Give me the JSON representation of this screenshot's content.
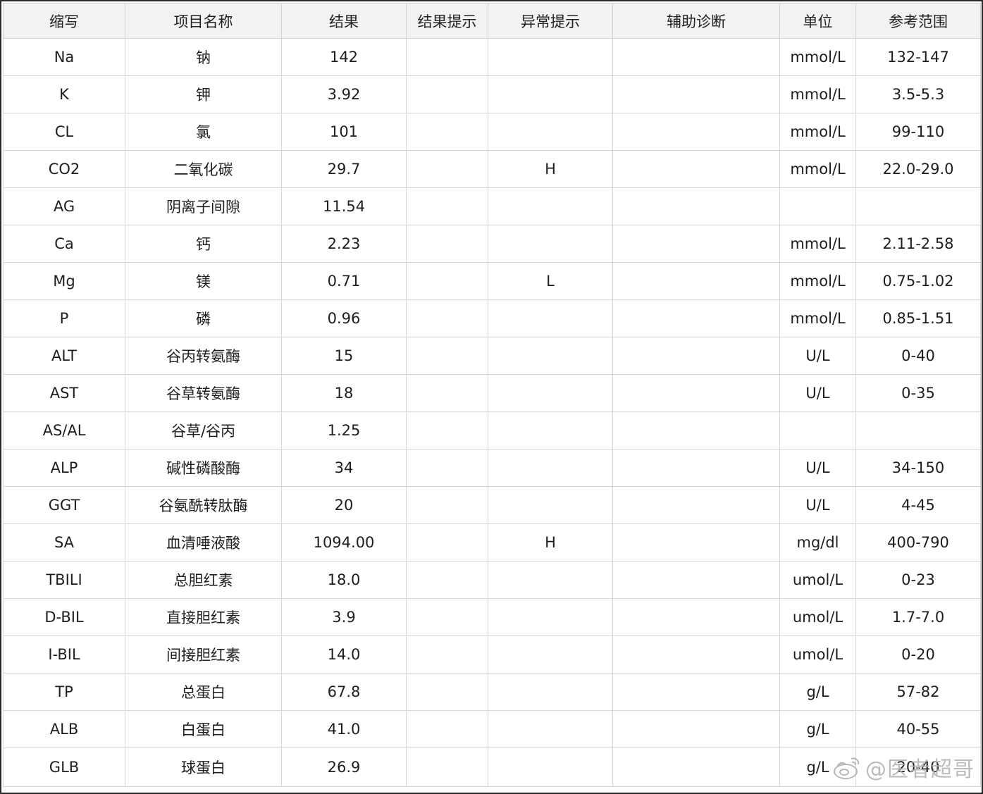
{
  "columns": [
    "缩写",
    "项目名称",
    "结果",
    "结果提示",
    "异常提示",
    "辅助诊断",
    "单位",
    "参考范围"
  ],
  "rows": [
    {
      "abbr": "Na",
      "name": "钠",
      "result": "142",
      "result_hint": "",
      "flag": "",
      "diagnosis": "",
      "unit": "mmol/L",
      "range": "132-147"
    },
    {
      "abbr": "K",
      "name": "钾",
      "result": "3.92",
      "result_hint": "",
      "flag": "",
      "diagnosis": "",
      "unit": "mmol/L",
      "range": "3.5-5.3"
    },
    {
      "abbr": "CL",
      "name": "氯",
      "result": "101",
      "result_hint": "",
      "flag": "",
      "diagnosis": "",
      "unit": "mmol/L",
      "range": "99-110"
    },
    {
      "abbr": "CO2",
      "name": "二氧化碳",
      "result": "29.7",
      "result_hint": "",
      "flag": "H",
      "diagnosis": "",
      "unit": "mmol/L",
      "range": "22.0-29.0"
    },
    {
      "abbr": "AG",
      "name": "阴离子间隙",
      "result": "11.54",
      "result_hint": "",
      "flag": "",
      "diagnosis": "",
      "unit": "",
      "range": ""
    },
    {
      "abbr": "Ca",
      "name": "钙",
      "result": "2.23",
      "result_hint": "",
      "flag": "",
      "diagnosis": "",
      "unit": "mmol/L",
      "range": "2.11-2.58"
    },
    {
      "abbr": "Mg",
      "name": "镁",
      "result": "0.71",
      "result_hint": "",
      "flag": "L",
      "diagnosis": "",
      "unit": "mmol/L",
      "range": "0.75-1.02"
    },
    {
      "abbr": "P",
      "name": "磷",
      "result": "0.96",
      "result_hint": "",
      "flag": "",
      "diagnosis": "",
      "unit": "mmol/L",
      "range": "0.85-1.51"
    },
    {
      "abbr": "ALT",
      "name": "谷丙转氨酶",
      "result": "15",
      "result_hint": "",
      "flag": "",
      "diagnosis": "",
      "unit": "U/L",
      "range": "0-40"
    },
    {
      "abbr": "AST",
      "name": "谷草转氨酶",
      "result": "18",
      "result_hint": "",
      "flag": "",
      "diagnosis": "",
      "unit": "U/L",
      "range": "0-35"
    },
    {
      "abbr": "AS/AL",
      "name": "谷草/谷丙",
      "result": "1.25",
      "result_hint": "",
      "flag": "",
      "diagnosis": "",
      "unit": "",
      "range": ""
    },
    {
      "abbr": "ALP",
      "name": "碱性磷酸酶",
      "result": "34",
      "result_hint": "",
      "flag": "",
      "diagnosis": "",
      "unit": "U/L",
      "range": "34-150"
    },
    {
      "abbr": "GGT",
      "name": "谷氨酰转肽酶",
      "result": "20",
      "result_hint": "",
      "flag": "",
      "diagnosis": "",
      "unit": "U/L",
      "range": "4-45"
    },
    {
      "abbr": "SA",
      "name": "血清唾液酸",
      "result": "1094.00",
      "result_hint": "",
      "flag": "H",
      "diagnosis": "",
      "unit": "mg/dl",
      "range": "400-790"
    },
    {
      "abbr": "TBILI",
      "name": "总胆红素",
      "result": "18.0",
      "result_hint": "",
      "flag": "",
      "diagnosis": "",
      "unit": "umol/L",
      "range": "0-23"
    },
    {
      "abbr": "D-BIL",
      "name": "直接胆红素",
      "result": "3.9",
      "result_hint": "",
      "flag": "",
      "diagnosis": "",
      "unit": "umol/L",
      "range": "1.7-7.0"
    },
    {
      "abbr": "I-BIL",
      "name": "间接胆红素",
      "result": "14.0",
      "result_hint": "",
      "flag": "",
      "diagnosis": "",
      "unit": "umol/L",
      "range": "0-20"
    },
    {
      "abbr": "TP",
      "name": "总蛋白",
      "result": "67.8",
      "result_hint": "",
      "flag": "",
      "diagnosis": "",
      "unit": "g/L",
      "range": "57-82"
    },
    {
      "abbr": "ALB",
      "name": "白蛋白",
      "result": "41.0",
      "result_hint": "",
      "flag": "",
      "diagnosis": "",
      "unit": "g/L",
      "range": "40-55"
    },
    {
      "abbr": "GLB",
      "name": "球蛋白",
      "result": "26.9",
      "result_hint": "",
      "flag": "",
      "diagnosis": "",
      "unit": "g/L",
      "range": "20-40"
    }
  ],
  "colors": {
    "high": "#e8161b",
    "low": "#1f1fd8",
    "text": "#1e1e1e",
    "header_bg": "#f2f2f2",
    "grid": "#d8d8d8"
  },
  "watermark": {
    "text": "@医者超哥",
    "icon": "weibo-logo-icon"
  }
}
